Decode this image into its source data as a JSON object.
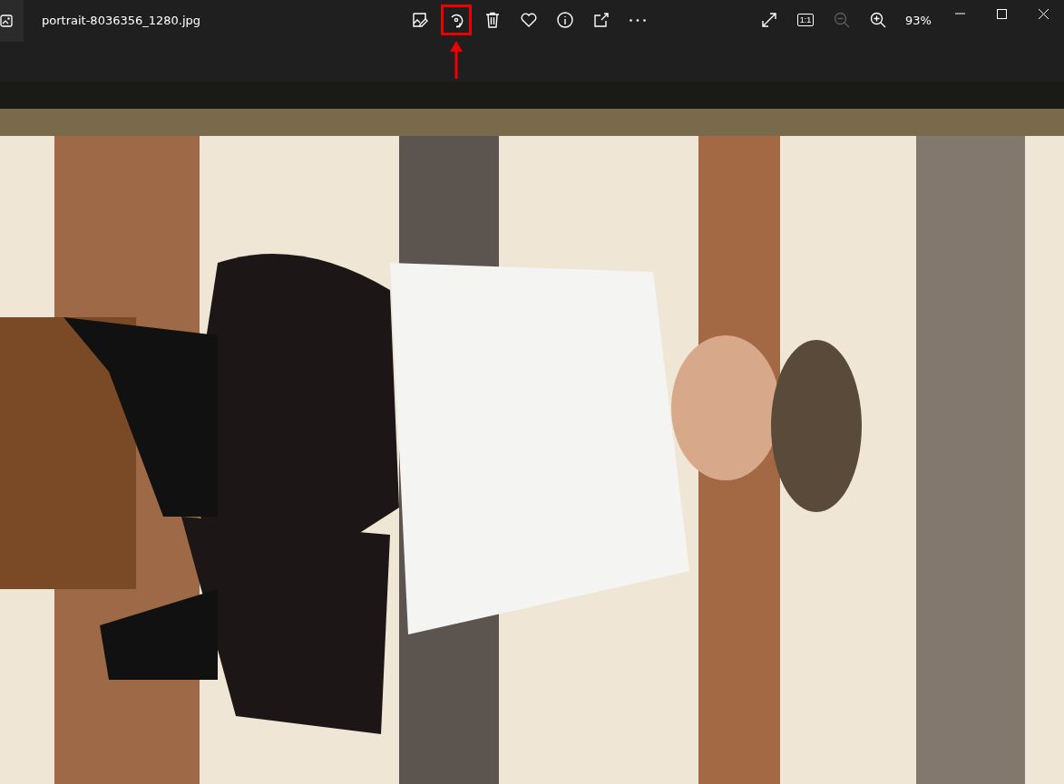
{
  "window": {
    "title": "portrait-8036356_1280.jpg"
  },
  "toolbar": [
    {
      "kind": "edit",
      "highlighted": false
    },
    {
      "kind": "rotate",
      "highlighted": true
    },
    {
      "kind": "delete",
      "highlighted": false
    },
    {
      "kind": "favorite",
      "highlighted": false
    },
    {
      "kind": "info",
      "highlighted": false
    },
    {
      "kind": "share",
      "highlighted": false
    },
    {
      "kind": "more",
      "highlighted": false
    }
  ],
  "view_controls": [
    {
      "kind": "fullscreen",
      "disabled": false
    },
    {
      "kind": "actual-size",
      "label": "1:1",
      "disabled": false
    },
    {
      "kind": "zoom-out",
      "disabled": true
    },
    {
      "kind": "zoom-in",
      "disabled": false
    }
  ],
  "zoom": "93%"
}
